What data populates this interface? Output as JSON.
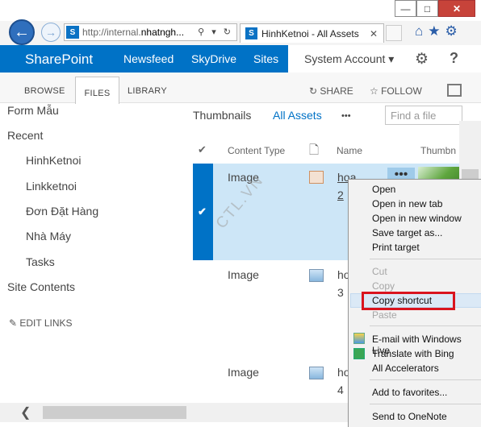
{
  "browser": {
    "window_buttons": {
      "minimize": "—",
      "maximize": "□",
      "close": "✕"
    },
    "address": {
      "prefix": "http://internal.",
      "host": "nhatngh...",
      "icons": "⚲ ▾ ↻"
    },
    "tab": {
      "title": "HinhKetnoi - All Assets",
      "close": "✕"
    },
    "toolbar_icons": "⌂★⚙"
  },
  "suite_bar": {
    "brand": "SharePoint",
    "links": [
      "Newsfeed",
      "SkyDrive",
      "Sites"
    ],
    "account": "System Account ▾",
    "settings": "⚙",
    "help": "?"
  },
  "ribbon": {
    "tabs": [
      "BROWSE",
      "FILES",
      "LIBRARY"
    ],
    "share": "SHARE",
    "follow": "FOLLOW"
  },
  "left_nav": {
    "form_mau": "Form Mẫu",
    "recent": "Recent",
    "items": [
      "HinhKetnoi",
      "Linkketnoi",
      "Đơn Đặt Hàng",
      "Nhà Máy",
      "Tasks"
    ],
    "site_contents": "Site Contents",
    "edit_links": "EDIT LINKS"
  },
  "views": {
    "thumbnails": "Thumbnails",
    "all_assets": "All Assets",
    "more": "•••",
    "find_placeholder": "Find a file"
  },
  "list": {
    "headers": {
      "content_type": "Content Type",
      "name": "Name",
      "thumbnail": "Thumbn"
    },
    "rows": [
      {
        "type": "Image",
        "name": "hoa",
        "sub": "2"
      },
      {
        "type": "Image",
        "name": "ho",
        "sub": "3"
      },
      {
        "type": "Image",
        "name": "ho",
        "sub": "4"
      }
    ],
    "ellipsis": "•••"
  },
  "watermark": "CTL.VN",
  "context_menu": {
    "items": [
      "Open",
      "Open in new tab",
      "Open in new window",
      "Save target as...",
      "Print target"
    ],
    "edit_items": [
      "Cut",
      "Copy",
      "Copy shortcut",
      "Paste"
    ],
    "accel_items": [
      "E-mail with Windows Live",
      "Translate with Bing",
      "All Accelerators"
    ],
    "favorites": "Add to favorites...",
    "onenote": "Send to OneNote"
  },
  "colors": {
    "accent": "#0072c6",
    "selection": "#cde6f7",
    "highlight_box": "#d9141e"
  }
}
